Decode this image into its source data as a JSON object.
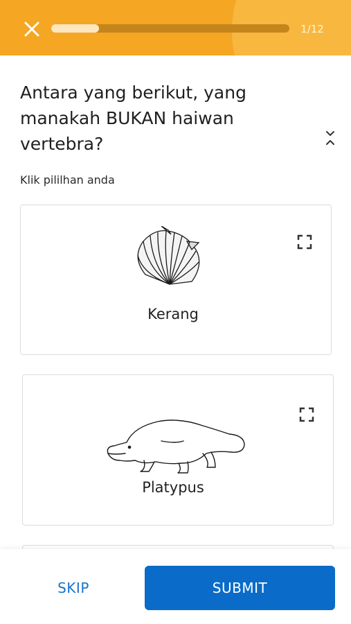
{
  "header": {
    "progress_label": "1/12",
    "progress_fraction": 0.2,
    "close_icon": "close-icon",
    "accent_color": "#f5a623"
  },
  "question": {
    "text": "Antara yang berikut, yang manakah BUKAN haiwan vertebra?",
    "collapse_icon": "collapse-chevrons-icon"
  },
  "instruction": "Klik pililhan anda",
  "options": [
    {
      "label": "Kerang",
      "image_icon": "scallop-shell-icon",
      "expand_icon": "expand-icon"
    },
    {
      "label": "Platypus",
      "image_icon": "platypus-icon",
      "expand_icon": "expand-icon"
    }
  ],
  "footer": {
    "skip_label": "SKIP",
    "submit_label": "SUBMIT",
    "submit_color": "#0a6bc8"
  }
}
